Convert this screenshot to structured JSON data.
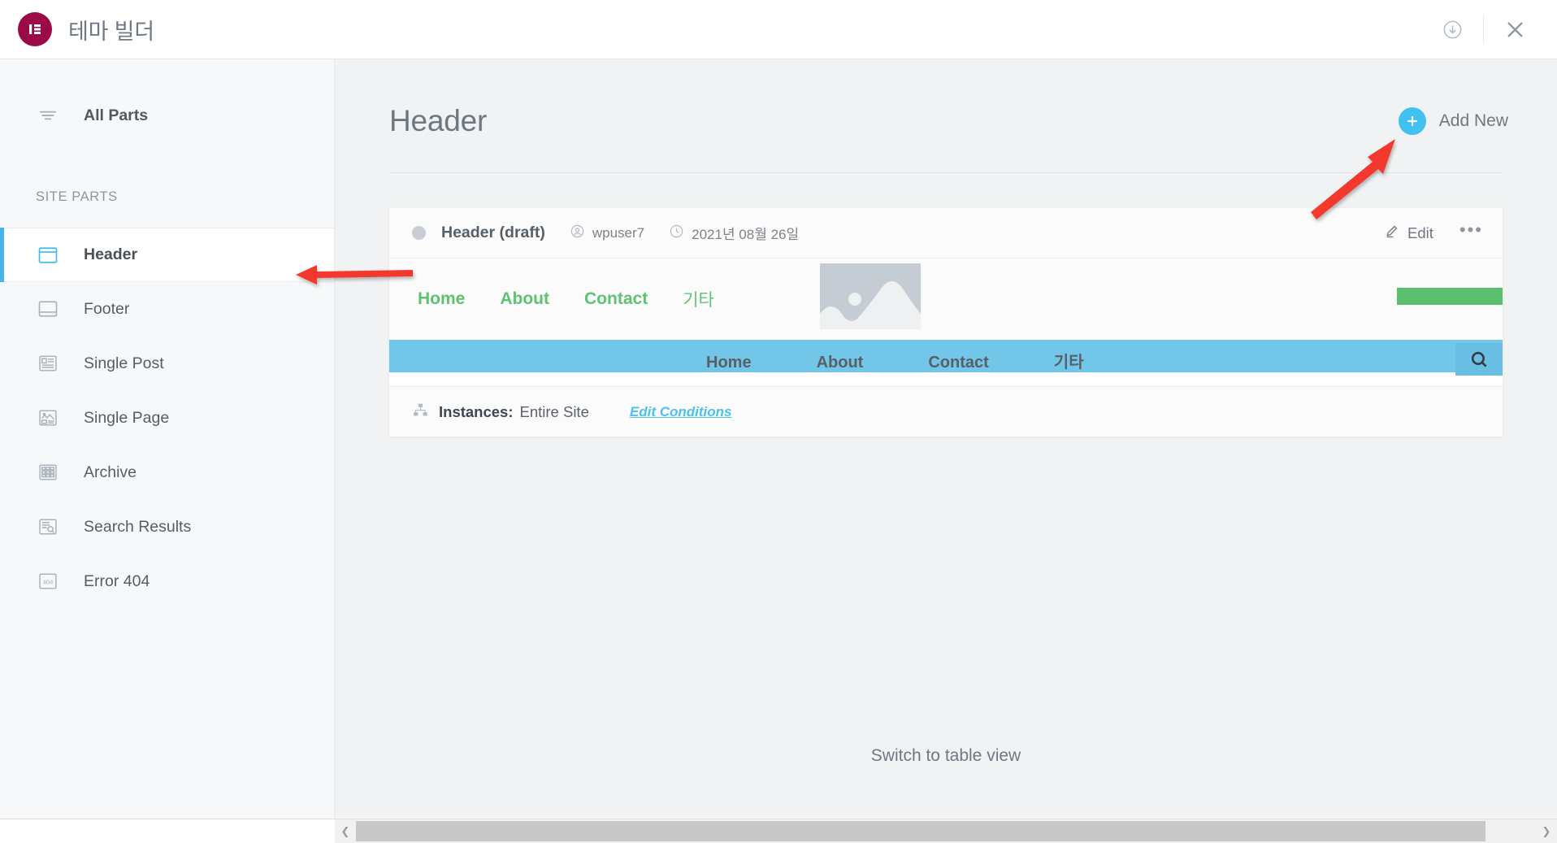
{
  "topbar": {
    "brand_title": "테마 빌더",
    "logo_icon": "elementor-logo-icon",
    "logo_color": "#9b0a46",
    "import_icon": "download-circle-icon",
    "close_icon": "close-icon"
  },
  "sidebar": {
    "all_parts": {
      "label": "All Parts",
      "icon": "filter-icon"
    },
    "section_title": "SITE PARTS",
    "parts": [
      {
        "label": "Header",
        "icon": "header-block-icon",
        "active": true
      },
      {
        "label": "Footer",
        "icon": "footer-block-icon",
        "active": false
      },
      {
        "label": "Single Post",
        "icon": "single-post-icon",
        "active": false
      },
      {
        "label": "Single Page",
        "icon": "single-page-icon",
        "active": false
      },
      {
        "label": "Archive",
        "icon": "archive-grid-icon",
        "active": false
      },
      {
        "label": "Search Results",
        "icon": "search-results-icon",
        "active": false
      },
      {
        "label": "Error 404",
        "icon": "error-404-icon",
        "active": false
      }
    ],
    "active_accent": "#45b5e8"
  },
  "main": {
    "page_title": "Header",
    "add_new": {
      "label": "Add New",
      "icon": "plus-circle-icon",
      "color": "#41c1f0"
    },
    "switch_view_label": "Switch to table view"
  },
  "card": {
    "status_dot_color": "#c7cdd2",
    "title": "Header (draft)",
    "author": {
      "icon": "user-circle-icon",
      "name": "wpuser7"
    },
    "date": {
      "icon": "clock-icon",
      "value": "2021년 08월 26일"
    },
    "edit": {
      "label": "Edit",
      "icon": "pencil-icon"
    },
    "more": {
      "icon": "more-horizontal-icon",
      "label": "•••"
    },
    "instances": {
      "icon": "sitemap-icon",
      "label": "Instances:",
      "value": "Entire Site",
      "link": "Edit Conditions",
      "link_color": "#4ec0ec"
    }
  },
  "preview": {
    "nav_links": [
      "Home",
      "About",
      "Contact",
      "기타"
    ],
    "nav_color": "#5dc271",
    "image_placeholder_icon": "image-placeholder-icon",
    "green_bar_color": "#5bbf6f",
    "blue_bar_color": "#72c6e8",
    "blue_nav_links": [
      "Home",
      "About",
      "Contact",
      "기타"
    ],
    "search_icon": "search-icon"
  },
  "scrollbar": {
    "left_arrow": "chevron-left-icon",
    "right_arrow": "chevron-right-icon"
  },
  "annotations": [
    {
      "name": "arrow-to-header-sidebar-item",
      "color": "#f4392f",
      "direction": "left"
    },
    {
      "name": "arrow-to-add-new-button",
      "color": "#f4392f",
      "direction": "up-right"
    }
  ]
}
